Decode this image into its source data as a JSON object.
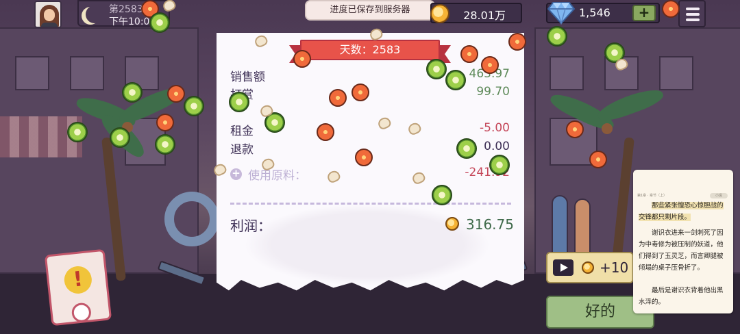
{
  "top_bar": {
    "day_label": "第2583",
    "time_label": "下午10:00",
    "toast": "进度已保存到服务器",
    "coins": "28.01万",
    "gems": "1,546",
    "add_label": "+"
  },
  "receipt": {
    "day_banner": "天数：2583",
    "rows": [
      {
        "label": "销售额",
        "value": "463.97"
      },
      {
        "label": "打赏",
        "value": "99.70"
      },
      {
        "label": "租金",
        "value": "-5.00"
      },
      {
        "label": "退款",
        "value": "0.00"
      },
      {
        "label": "使用原料：",
        "value": "-241.92"
      }
    ],
    "profit_label": "利润：",
    "profit_value": "316.75"
  },
  "ad_reward": "+10",
  "ok_button": "好的",
  "book": {
    "header": "第1章 · 章节（上）",
    "header_pill": "小说",
    "paragraphs": [
      "那些紧张惶恐心惊胆战的交锋都只剩片段。",
      "谢识衣进来一剑刺死了因为中毒修为被压制的妖道，他们得到了玉灵芝，而言卿腿被倾塌的桌子压骨折了。",
      "最后是谢识衣背着他出黑水泽的。"
    ]
  },
  "colors": {
    "positive": "#5e8a5a",
    "negative": "#c5485a",
    "ribbon": "#e8534a",
    "ok_button": "#9fbf86"
  },
  "icons": [
    "avatar",
    "moon-icon",
    "coin-icon",
    "diamond-icon",
    "menu-icon",
    "play-icon",
    "alert-icon"
  ]
}
